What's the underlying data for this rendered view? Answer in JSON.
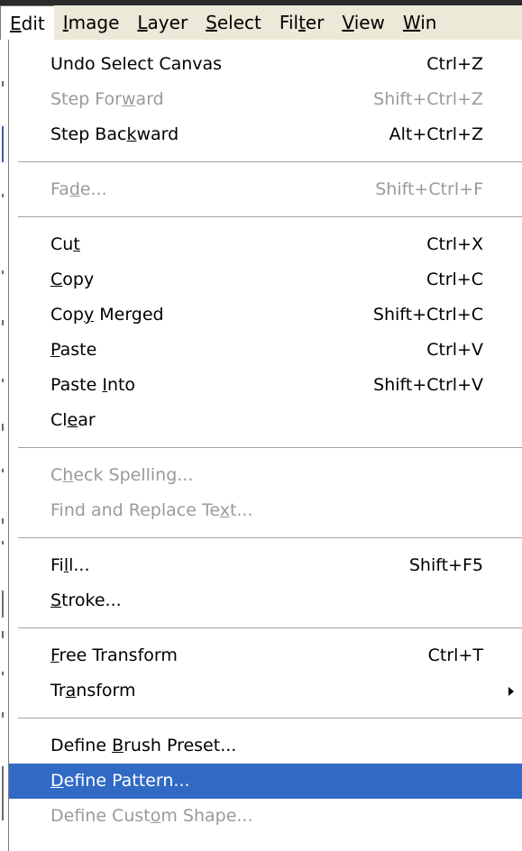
{
  "menubar": {
    "items": [
      {
        "label_pre": "",
        "label_u": "E",
        "label_post": "dit",
        "active": true
      },
      {
        "label_pre": "",
        "label_u": "I",
        "label_post": "mage",
        "active": false
      },
      {
        "label_pre": "",
        "label_u": "L",
        "label_post": "ayer",
        "active": false
      },
      {
        "label_pre": "",
        "label_u": "S",
        "label_post": "elect",
        "active": false
      },
      {
        "label_pre": "Fil",
        "label_u": "t",
        "label_post": "er",
        "active": false
      },
      {
        "label_pre": "",
        "label_u": "V",
        "label_post": "iew",
        "active": false
      },
      {
        "label_pre": "",
        "label_u": "W",
        "label_post": "in",
        "active": false
      }
    ]
  },
  "edit_menu": {
    "groups": [
      [
        {
          "pre": "Undo Select Canvas",
          "u": "",
          "post": "",
          "shortcut": "Ctrl+Z",
          "disabled": false
        },
        {
          "pre": "Step For",
          "u": "w",
          "post": "ard",
          "shortcut": "Shift+Ctrl+Z",
          "disabled": true
        },
        {
          "pre": "Step Bac",
          "u": "k",
          "post": "ward",
          "shortcut": "Alt+Ctrl+Z",
          "disabled": false
        }
      ],
      [
        {
          "pre": "Fa",
          "u": "d",
          "post": "e...",
          "shortcut": "Shift+Ctrl+F",
          "disabled": true
        }
      ],
      [
        {
          "pre": "Cu",
          "u": "t",
          "post": "",
          "shortcut": "Ctrl+X",
          "disabled": false
        },
        {
          "pre": "",
          "u": "C",
          "post": "opy",
          "shortcut": "Ctrl+C",
          "disabled": false
        },
        {
          "pre": "Cop",
          "u": "y",
          "post": " Merged",
          "shortcut": "Shift+Ctrl+C",
          "disabled": false
        },
        {
          "pre": "",
          "u": "P",
          "post": "aste",
          "shortcut": "Ctrl+V",
          "disabled": false
        },
        {
          "pre": "Paste ",
          "u": "I",
          "post": "nto",
          "shortcut": "Shift+Ctrl+V",
          "disabled": false
        },
        {
          "pre": "Cl",
          "u": "e",
          "post": "ar",
          "shortcut": "",
          "disabled": false
        }
      ],
      [
        {
          "pre": "C",
          "u": "h",
          "post": "eck Spelling...",
          "shortcut": "",
          "disabled": true
        },
        {
          "pre": "Find and Replace Te",
          "u": "x",
          "post": "t...",
          "shortcut": "",
          "disabled": true
        }
      ],
      [
        {
          "pre": "Fi",
          "u": "l",
          "post": "l...",
          "shortcut": "Shift+F5",
          "disabled": false
        },
        {
          "pre": "",
          "u": "S",
          "post": "troke...",
          "shortcut": "",
          "disabled": false
        }
      ],
      [
        {
          "pre": "",
          "u": "F",
          "post": "ree Transform",
          "shortcut": "Ctrl+T",
          "disabled": false
        },
        {
          "pre": "Tr",
          "u": "a",
          "post": "nsform",
          "shortcut": "",
          "disabled": false,
          "submenu": true
        }
      ],
      [
        {
          "pre": "Define ",
          "u": "B",
          "post": "rush Preset...",
          "shortcut": "",
          "disabled": false
        },
        {
          "pre": "",
          "u": "D",
          "post": "efine Pattern...",
          "shortcut": "",
          "disabled": false,
          "highlight": true
        },
        {
          "pre": "Define Cust",
          "u": "o",
          "post": "m Shape...",
          "shortcut": "",
          "disabled": true
        }
      ]
    ]
  }
}
